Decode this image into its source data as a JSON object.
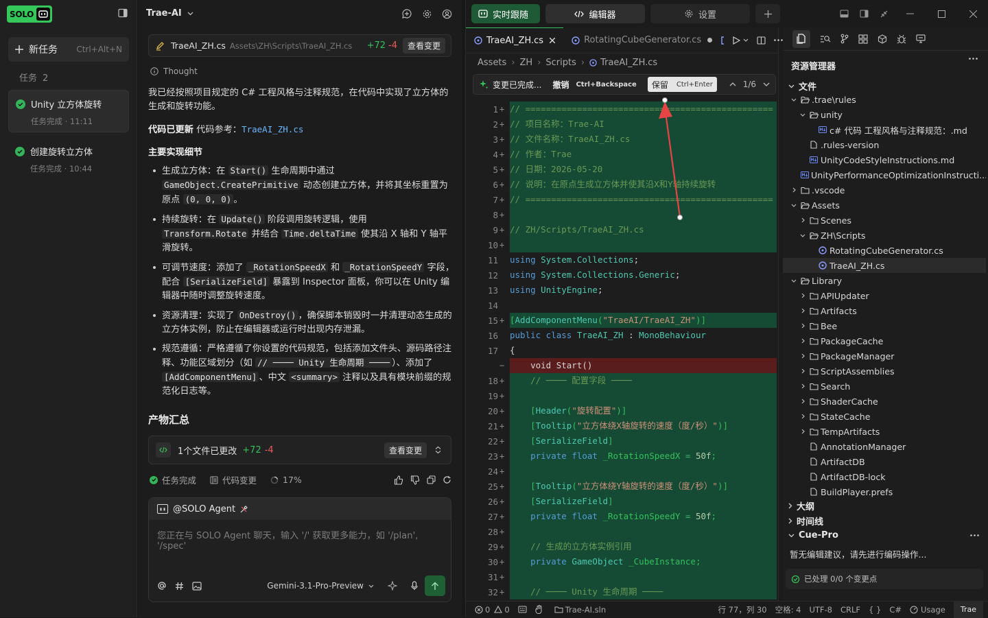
{
  "brand": {
    "logo_text": "SOLO",
    "accent": "#34c759"
  },
  "sidebar": {
    "new_task_label": "新任务",
    "new_task_shortcut": "Ctrl+Alt+N",
    "tasks_label": "任务",
    "tasks_count": "2",
    "tasks": [
      {
        "name": "Unity 立方体旋转",
        "sub": "任务完成 · 11:11",
        "active": true
      },
      {
        "name": "创建旋转立方体",
        "sub": "任务完成 · 10:44",
        "active": false
      }
    ]
  },
  "chat": {
    "title": "Trae-AI",
    "file_card": {
      "name": "TraeAI_ZH.cs",
      "path": "Assets\\ZH\\Scripts\\TraeAI_ZH.cs",
      "added": "+72",
      "removed": "-4",
      "button": "查看变更"
    },
    "thought_label": "Thought",
    "intro": "我已经按照项目规定的 C# 工程风格与注释规范，在代码中实现了立方体的生成和旋转功能。",
    "updated_label": "代码已更新",
    "ref_label": "代码参考：",
    "ref_file": "TraeAI_ZH.cs",
    "details_title": "主要实现细节",
    "bullets": [
      {
        "a": "生成立方体：在 ",
        "c1": "Start()",
        "b": " 生命周期中通过 ",
        "c2": "GameObject.CreatePrimitive",
        "d": " 动态创建立方体，并将其坐标重置为原点 ",
        "c3": "(0, 0, 0)",
        "e": "。"
      },
      {
        "a": "持续旋转：在 ",
        "c1": "Update()",
        "b": " 阶段调用旋转逻辑，使用 ",
        "c2": "Transform.Rotate",
        "d": " 并结合 ",
        "c3": "Time.deltaTime",
        "e": " 使其沿 X 轴和 Y 轴平滑旋转。"
      },
      {
        "a": "可调节速度：添加了 ",
        "c1": "_RotationSpeedX",
        "b": " 和 ",
        "c2": "_RotationSpeedY",
        "d": " 字段，配合 ",
        "c3": "[SerializeField]",
        "e": " 暴露到 Inspector 面板，你可以在 Unity 编辑器中随时调整旋转速度。"
      },
      {
        "a": "资源清理：实现了 ",
        "c1": "OnDestroy()",
        "b": "，确保脚本销毁时一并清理动态生成的立方体实例，防止在编辑器或运行时出现内存泄漏。",
        "c2": "",
        "d": "",
        "c3": "",
        "e": ""
      },
      {
        "a": "规范遵循：严格遵循了你设置的代码规范，包括添加文件头、源码路径注释、功能区域划分（如 ",
        "c1": "// ──── Unity 生命周期 ────",
        "b": "）、添加了 ",
        "c2": "[AddComponentMenu]",
        "d": "、中文 ",
        "c3": "<summary>",
        "e": " 注释以及具有模块前缀的规范化日志等。"
      }
    ],
    "products_title": "产物汇总",
    "files_changed": {
      "label": "1个文件已更改",
      "added": "+72",
      "removed": "-4",
      "button": "查看变更"
    },
    "status": {
      "done": "任务完成",
      "changes": "代码变更",
      "percent": "17%"
    },
    "input": {
      "agent": "@SOLO Agent",
      "placeholder": "您正在与 SOLO Agent 聊天，输入 '/' 获取更多能力，如 '/plan', '/spec'",
      "model": "Gemini-3.1-Pro-Preview"
    }
  },
  "topbar": {
    "follow": "实时跟随",
    "editor": "编辑器",
    "settings": "设置"
  },
  "editor": {
    "tabs": [
      {
        "name": "TraeAI_ZH.cs",
        "active": true
      },
      {
        "name": "RotatingCubeGenerator.cs",
        "active": false
      }
    ],
    "breadcrumb": [
      "Assets",
      "ZH",
      "Scripts",
      "TraeAI_ZH.cs"
    ],
    "diffbar": {
      "title": "变更已完成...",
      "undo": "撤销",
      "undo_key": "Ctrl+Backspace",
      "keep": "保留",
      "keep_key": "Ctrl+Enter",
      "count": "1/6"
    },
    "lines": [
      {
        "n": "1",
        "m": "+",
        "t": "// ================================================",
        "c": "cm",
        "bg": "add"
      },
      {
        "n": "2",
        "m": "+",
        "t": "// 项目名称：Trae-AI",
        "c": "cm",
        "bg": "add"
      },
      {
        "n": "3",
        "m": "+",
        "t": "// 文件名称：TraeAI_ZH.cs",
        "c": "cm",
        "bg": "add"
      },
      {
        "n": "4",
        "m": "+",
        "t": "// 作者：Trae",
        "c": "cm",
        "bg": "add"
      },
      {
        "n": "5",
        "m": "+",
        "t": "// 日期：2026-05-20",
        "c": "cm",
        "bg": "add"
      },
      {
        "n": "6",
        "m": "+",
        "t": "// 说明：在原点生成立方体并使其沿X和Y轴持续旋转",
        "c": "cm",
        "bg": "add"
      },
      {
        "n": "7",
        "m": "+",
        "t": "// ================================================",
        "c": "cm",
        "bg": "add"
      },
      {
        "n": "8",
        "m": "+",
        "t": "",
        "c": "cm",
        "bg": "add"
      },
      {
        "n": "9",
        "m": "+",
        "t": "// ZH/Scripts/TraeAI_ZH.cs",
        "c": "cm",
        "bg": "add"
      },
      {
        "n": "10",
        "m": "+",
        "t": "",
        "c": "cm",
        "bg": "add"
      },
      {
        "n": "11",
        "m": "",
        "t": "using System.Collections;",
        "c": "use",
        "bg": ""
      },
      {
        "n": "12",
        "m": "",
        "t": "using System.Collections.Generic;",
        "c": "use",
        "bg": ""
      },
      {
        "n": "13",
        "m": "",
        "t": "using UnityEngine;",
        "c": "use",
        "bg": ""
      },
      {
        "n": "14",
        "m": "",
        "t": "",
        "c": "tx",
        "bg": ""
      },
      {
        "n": "15",
        "m": "+",
        "t": "[AddComponentMenu(\"TraeAI/TraeAI_ZH\")]",
        "c": "at",
        "bg": "add"
      },
      {
        "n": "16",
        "m": "",
        "t": "public class TraeAI_ZH : MonoBehaviour",
        "c": "cls",
        "bg": ""
      },
      {
        "n": "17",
        "m": "",
        "t": "{",
        "c": "tx",
        "bg": ""
      },
      {
        "n": "",
        "m": "−",
        "t": "    void Start()",
        "c": "tx",
        "bg": "rem"
      },
      {
        "n": "18",
        "m": "+",
        "t": "    // ──── 配置字段 ────",
        "c": "cm",
        "bg": "add"
      },
      {
        "n": "19",
        "m": "+",
        "t": "",
        "c": "tx",
        "bg": "add"
      },
      {
        "n": "20",
        "m": "+",
        "t": "    [Header(\"旋转配置\")]",
        "c": "at",
        "bg": "add"
      },
      {
        "n": "21",
        "m": "+",
        "t": "    [Tooltip(\"立方体绕X轴旋转的速度（度/秒）\")]",
        "c": "at",
        "bg": "add"
      },
      {
        "n": "22",
        "m": "+",
        "t": "    [SerializeField]",
        "c": "ty",
        "bg": "add"
      },
      {
        "n": "23",
        "m": "+",
        "t": "    private float _RotationSpeedX = 50f;",
        "c": "fld",
        "bg": "add"
      },
      {
        "n": "24",
        "m": "+",
        "t": "",
        "c": "tx",
        "bg": "add"
      },
      {
        "n": "25",
        "m": "+",
        "t": "    [Tooltip(\"立方体绕Y轴旋转的速度（度/秒）\")]",
        "c": "at",
        "bg": "add"
      },
      {
        "n": "26",
        "m": "+",
        "t": "    [SerializeField]",
        "c": "ty",
        "bg": "add"
      },
      {
        "n": "27",
        "m": "+",
        "t": "    private float _RotationSpeedY = 50f;",
        "c": "fld",
        "bg": "add"
      },
      {
        "n": "28",
        "m": "+",
        "t": "",
        "c": "tx",
        "bg": "add"
      },
      {
        "n": "29",
        "m": "+",
        "t": "    // 生成的立方体实例引用",
        "c": "cm",
        "bg": "add"
      },
      {
        "n": "30",
        "m": "+",
        "t": "    private GameObject _CubeInstance;",
        "c": "fld",
        "bg": "add"
      },
      {
        "n": "31",
        "m": "+",
        "t": "",
        "c": "tx",
        "bg": "add"
      },
      {
        "n": "32",
        "m": "+",
        "t": "    // ──── Unity 生命周期 ────",
        "c": "cm",
        "bg": "add"
      }
    ]
  },
  "explorer": {
    "title": "资源管理器",
    "files_section": "文件",
    "tree": [
      {
        "d": 1,
        "k": "folder",
        "open": true,
        "n": ".trae\\rules"
      },
      {
        "d": 2,
        "k": "folder",
        "open": true,
        "n": "unity"
      },
      {
        "d": 3,
        "k": "md",
        "n": "c# 代码 工程风格与注释规范：.md"
      },
      {
        "d": 2,
        "k": "file",
        "n": ".rules-version"
      },
      {
        "d": 2,
        "k": "md",
        "n": "UnityCodeStyleInstructions.md"
      },
      {
        "d": 2,
        "k": "md",
        "n": "UnityPerformanceOptimizationInstructi..."
      },
      {
        "d": 1,
        "k": "folder",
        "open": false,
        "n": ".vscode"
      },
      {
        "d": 1,
        "k": "folder",
        "open": true,
        "n": "Assets"
      },
      {
        "d": 2,
        "k": "folder",
        "open": false,
        "n": "Scenes"
      },
      {
        "d": 2,
        "k": "folder",
        "open": true,
        "n": "ZH\\Scripts"
      },
      {
        "d": 3,
        "k": "cs",
        "n": "RotatingCubeGenerator.cs"
      },
      {
        "d": 3,
        "k": "cs",
        "n": "TraeAI_ZH.cs",
        "sel": true
      },
      {
        "d": 1,
        "k": "folder",
        "open": true,
        "n": "Library"
      },
      {
        "d": 2,
        "k": "folder",
        "open": false,
        "n": "APIUpdater"
      },
      {
        "d": 2,
        "k": "folder",
        "open": false,
        "n": "Artifacts"
      },
      {
        "d": 2,
        "k": "folder",
        "open": false,
        "n": "Bee"
      },
      {
        "d": 2,
        "k": "folder",
        "open": false,
        "n": "PackageCache"
      },
      {
        "d": 2,
        "k": "folder",
        "open": false,
        "n": "PackageManager"
      },
      {
        "d": 2,
        "k": "folder",
        "open": false,
        "n": "ScriptAssemblies"
      },
      {
        "d": 2,
        "k": "folder",
        "open": false,
        "n": "Search"
      },
      {
        "d": 2,
        "k": "folder",
        "open": false,
        "n": "ShaderCache"
      },
      {
        "d": 2,
        "k": "folder",
        "open": false,
        "n": "StateCache"
      },
      {
        "d": 2,
        "k": "folder",
        "open": false,
        "n": "TempArtifacts"
      },
      {
        "d": 2,
        "k": "file",
        "n": "AnnotationManager"
      },
      {
        "d": 2,
        "k": "file",
        "n": "ArtifactDB"
      },
      {
        "d": 2,
        "k": "file",
        "n": "ArtifactDB-lock"
      },
      {
        "d": 2,
        "k": "file",
        "n": "BuildPlayer.prefs"
      }
    ],
    "outline": "大纲",
    "timeline": "时间线",
    "cuepro": {
      "title": "Cue-Pro",
      "message": "暂无编辑建议，请先进行编码操作...",
      "processed": "已处理 0/0 个变更点"
    }
  },
  "statusbar": {
    "errors": "0",
    "warnings": "0",
    "solution": "Trae-AI.sln",
    "position": "行 77，列 30",
    "spaces": "空格: 4",
    "encoding": "UTF-8",
    "eol": "CRLF",
    "braces": "{ }",
    "lang": "C#",
    "usage": "Usage",
    "badge": "Trae"
  }
}
